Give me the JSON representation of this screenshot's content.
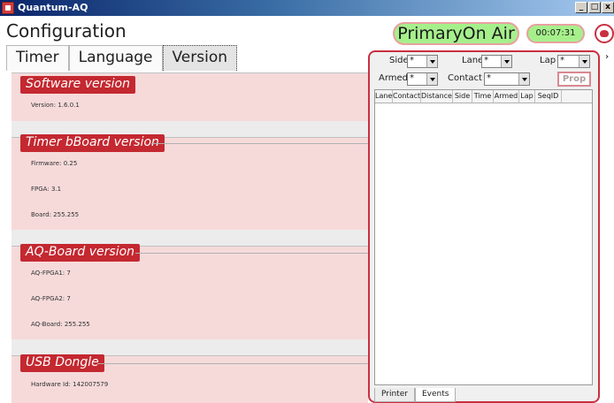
{
  "window": {
    "title": "Quantum-AQ",
    "buttons": [
      "_",
      "□",
      "x"
    ]
  },
  "header": {
    "page_title": "Configuration",
    "status": "PrimaryOn Air",
    "clock": "00:07:31",
    "user_icon": "user-icon"
  },
  "tabs": [
    {
      "label": "Timer",
      "active": false
    },
    {
      "label": "Language",
      "active": false
    },
    {
      "label": "Version",
      "active": true
    }
  ],
  "sections": {
    "software": {
      "title": "Software version",
      "version_label": "Version:",
      "version_value": "1.6.0.1"
    },
    "timer_board": {
      "title": "Timer bBoard version",
      "firmware_label": "Firmware:",
      "firmware_value": "0.25",
      "fpga_label": "FPGA:",
      "fpga_value": "3.1",
      "board_label": "Board:",
      "board_value": "255.255"
    },
    "aq_board": {
      "title": "AQ-Board version",
      "fpga1_label": "AQ-FPGA1:",
      "fpga1_value": "7",
      "fpga2_label": "AQ-FPGA2:",
      "fpga2_value": "7",
      "board_label": "AQ-Board:",
      "board_value": "255.255"
    },
    "usb": {
      "title": "USB Dongle",
      "hw_label": "Hardware Id:",
      "hw_value": "142007579"
    }
  },
  "events_panel": {
    "filters": {
      "side": {
        "label": "Side",
        "value": "*"
      },
      "lane": {
        "label": "Lane",
        "value": "*"
      },
      "lap": {
        "label": "Lap",
        "value": "*"
      },
      "armed": {
        "label": "Armed",
        "value": "*"
      },
      "contact": {
        "label": "Contact",
        "value": "*"
      }
    },
    "prop_button": "Prop",
    "columns": [
      "Lane",
      "Contact",
      "Distance",
      "Side",
      "Time",
      "Armed",
      "Lap",
      "SeqID"
    ],
    "rows": [],
    "bottom_tabs": [
      {
        "label": "Printer",
        "active": false
      },
      {
        "label": "Events",
        "active": true
      }
    ],
    "expand_icon": "chevron-right-icon"
  },
  "colors": {
    "accent_red": "#c42830",
    "status_green": "#a6f08c",
    "section_bg": "#f6dada"
  }
}
